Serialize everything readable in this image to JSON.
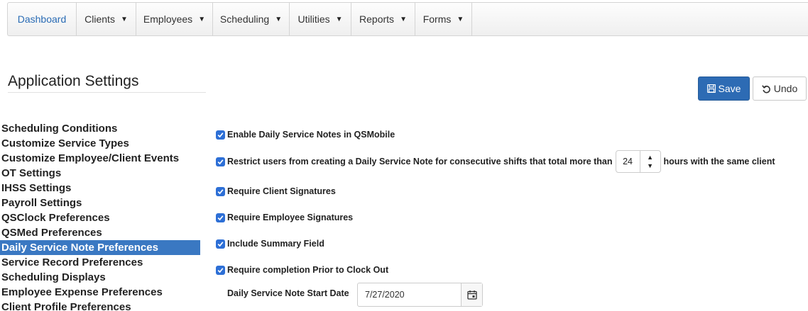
{
  "nav": {
    "items": [
      {
        "label": "Dashboard",
        "dropdown": false,
        "active": true
      },
      {
        "label": "Clients",
        "dropdown": true
      },
      {
        "label": "Employees",
        "dropdown": true
      },
      {
        "label": "Scheduling",
        "dropdown": true
      },
      {
        "label": "Utilities",
        "dropdown": true
      },
      {
        "label": "Reports",
        "dropdown": true
      },
      {
        "label": "Forms",
        "dropdown": true
      }
    ],
    "caret": "▼",
    "active_color": "#2a6cb5"
  },
  "page": {
    "title": "Application Settings"
  },
  "toolbar": {
    "save_label": "Save",
    "save_icon": "floppy-disk-icon",
    "undo_label": "Undo",
    "undo_icon": "undo-arrow-icon",
    "save_color": "#2d6bb4"
  },
  "sidebar": {
    "items": [
      {
        "label": "Scheduling Conditions"
      },
      {
        "label": "Customize Service Types"
      },
      {
        "label": "Customize Employee/Client Events"
      },
      {
        "label": "OT Settings"
      },
      {
        "label": "IHSS Settings"
      },
      {
        "label": "Payroll Settings"
      },
      {
        "label": "QSClock Preferences"
      },
      {
        "label": "QSMed Preferences"
      },
      {
        "label": "Daily Service Note Preferences",
        "selected": true
      },
      {
        "label": "Service Record Preferences"
      },
      {
        "label": "Scheduling Displays"
      },
      {
        "label": "Employee Expense Preferences"
      },
      {
        "label": "Client Profile Preferences"
      }
    ],
    "selected_color": "#3a78c2"
  },
  "settings": {
    "enable_dsn": {
      "label": "Enable Daily Service Notes in QSMobile",
      "checked": true
    },
    "restrict": {
      "label_before": "Restrict users from creating a Daily Service Note for consecutive shifts that total more than",
      "hours_value": "24",
      "label_after": "hours with the same client",
      "checked": true
    },
    "client_signatures": {
      "label": "Require Client Signatures",
      "checked": true
    },
    "employee_signatures": {
      "label": "Require Employee Signatures",
      "checked": true
    },
    "summary_field": {
      "label": "Include Summary Field",
      "checked": true
    },
    "completion": {
      "label": "Require completion Prior to Clock Out",
      "checked": true
    },
    "start_date": {
      "label": "Daily Service Note Start Date",
      "value": "7/27/2020",
      "icon": "calendar-icon"
    },
    "checkbox_color": "#2d6fd6"
  }
}
